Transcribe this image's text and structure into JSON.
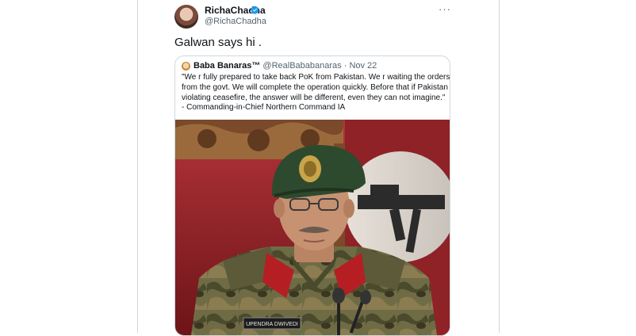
{
  "tweet": {
    "display_name": "RichaChadha",
    "handle": "@RichaChadha",
    "text": "Galwan says hi .",
    "more_icon": "more-horizontal-icon",
    "verified_icon": "verified-badge-icon"
  },
  "quote": {
    "name": "Baba Banaras™",
    "meta": " @RealBababanaras · Nov 22",
    "lines": [
      "\"We r fully prepared to take back PoK from Pakistan. We r waiting the orders",
      "from the govt. We will complete the operation quickly. Before that if Pakistan is",
      "violating ceasefire, the answer will be different, even they can not imagine.\"",
      "- Commanding-in-Chief Northern Command IA"
    ],
    "photo_nameplate": "UPENDRA DWIVEDI"
  },
  "colors": {
    "verified_blue": "#1d9bf0",
    "secondary_text": "#536471",
    "border": "#cfd9de"
  }
}
